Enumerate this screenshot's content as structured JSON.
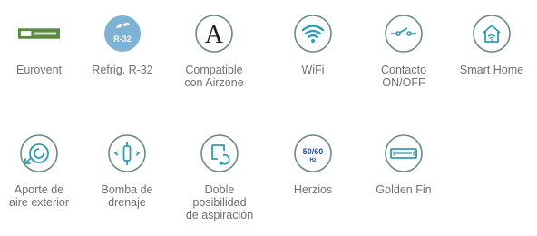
{
  "colors": {
    "stroke": "#6a8a86",
    "teal": "#2e9db1",
    "text": "#6f6f6f",
    "eurovent": "#5b8b3f",
    "r32_circle": "#7fb3d6",
    "r32_text": "#ffffff",
    "hz_text": "#1f4d8f"
  },
  "features": [
    {
      "label": "Eurovent",
      "icon": "eurovent-logo"
    },
    {
      "label": "Refrig. R-32",
      "icon": "r32-refrigerant-icon",
      "badge": "R-32"
    },
    {
      "label": "Compatible\ncon Airzone",
      "icon": "airzone-icon",
      "glyph": "A"
    },
    {
      "label": "WiFi",
      "icon": "wifi-icon"
    },
    {
      "label": "Contacto\nON/OFF",
      "icon": "on-off-contact-icon"
    },
    {
      "label": "Smart Home",
      "icon": "smart-home-icon"
    },
    {
      "label": "Aporte de\naire exterior",
      "icon": "outdoor-air-icon"
    },
    {
      "label": "Bomba de\ndrenaje",
      "icon": "drain-pump-icon"
    },
    {
      "label": "Doble\nposibilidad\nde aspiración",
      "icon": "dual-intake-icon"
    },
    {
      "label": "Herzios",
      "icon": "hertz-icon",
      "hz_top": "50/60",
      "hz_bottom": "Hz"
    },
    {
      "label": "Golden Fin",
      "icon": "golden-fin-icon"
    }
  ]
}
